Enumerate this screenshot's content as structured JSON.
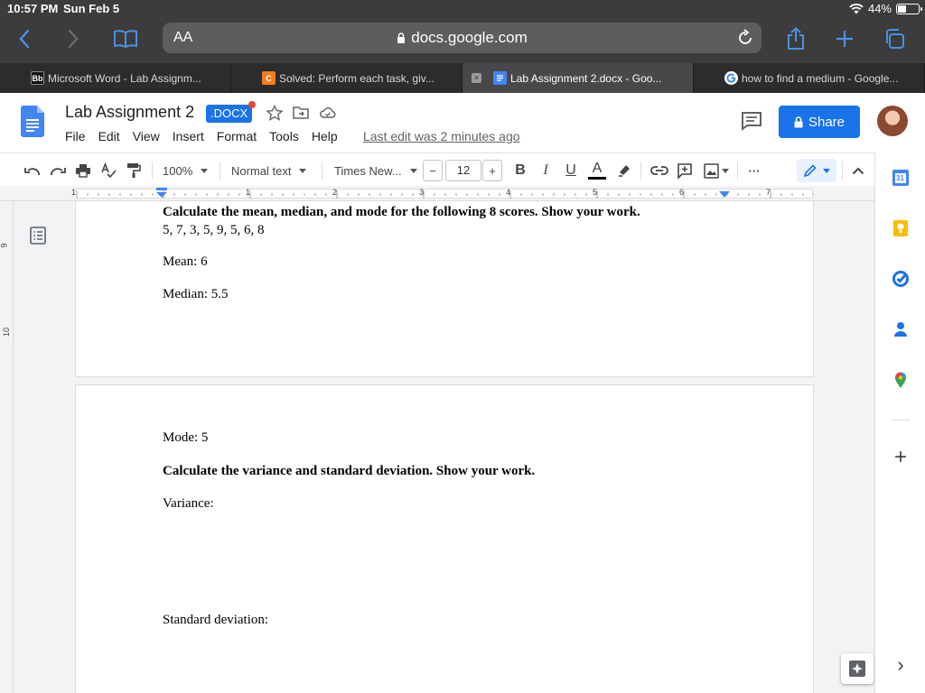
{
  "status_bar": {
    "time": "10:57 PM",
    "date": "Sun Feb 5",
    "battery_text": "44%",
    "battery_level": 0.44
  },
  "safari": {
    "aa_label": "AA",
    "url": "docs.google.com",
    "tabs": [
      {
        "label": "Microsoft Word - Lab Assignm...",
        "favicon": "Bb",
        "favicon_color": "#111111",
        "active": false
      },
      {
        "label": "Solved: Perform each task, giv...",
        "favicon": "C",
        "favicon_color": "#f47d20",
        "active": false
      },
      {
        "label": "Lab Assignment 2.docx - Goo...",
        "favicon": "docs",
        "favicon_color": "#4285f4",
        "active": true,
        "close": "×"
      },
      {
        "label": "how to find a medium - Google...",
        "favicon": "G",
        "favicon_color": "#ffffff",
        "active": false
      }
    ]
  },
  "doc_header": {
    "title": "Lab Assignment 2",
    "badge": ".DOCX",
    "menu": [
      "File",
      "Edit",
      "View",
      "Insert",
      "Format",
      "Tools",
      "Help"
    ],
    "last_edit": "Last edit was 2 minutes ago",
    "share_label": "Share",
    "accent": "#1a73e8"
  },
  "toolbar": {
    "zoom": "100%",
    "style": "Normal text",
    "font": "Times New...",
    "font_size": "12",
    "minus": "−",
    "plus": "+",
    "bold": "B",
    "italic": "I",
    "underline": "U",
    "text_color": "A",
    "more": "···"
  },
  "ruler": {
    "labels": [
      "1",
      "1",
      "2",
      "3",
      "4",
      "5",
      "6",
      "7"
    ]
  },
  "vruler": {
    "labels": [
      "9",
      "10"
    ]
  },
  "document": {
    "page1": [
      {
        "text": "Calculate the mean, median, and mode for the following 8 scores. Show your work.",
        "bold": true
      },
      {
        "text": " 5, 7, 3, 5, 9, 5, 6, 8",
        "bold": false
      },
      {
        "text": "Mean: 6",
        "bold": false
      },
      {
        "text": "Median: 5.5",
        "bold": false
      }
    ],
    "page2": [
      {
        "text": "Mode: 5",
        "bold": false
      },
      {
        "text": "Calculate the variance and standard deviation. Show your work.",
        "bold": true
      },
      {
        "text": "Variance:",
        "bold": false
      },
      {
        "text": "Standard deviation:",
        "bold": false
      }
    ]
  },
  "side_panel": {
    "calendar_day": "31",
    "add": "+",
    "expand": "›"
  }
}
